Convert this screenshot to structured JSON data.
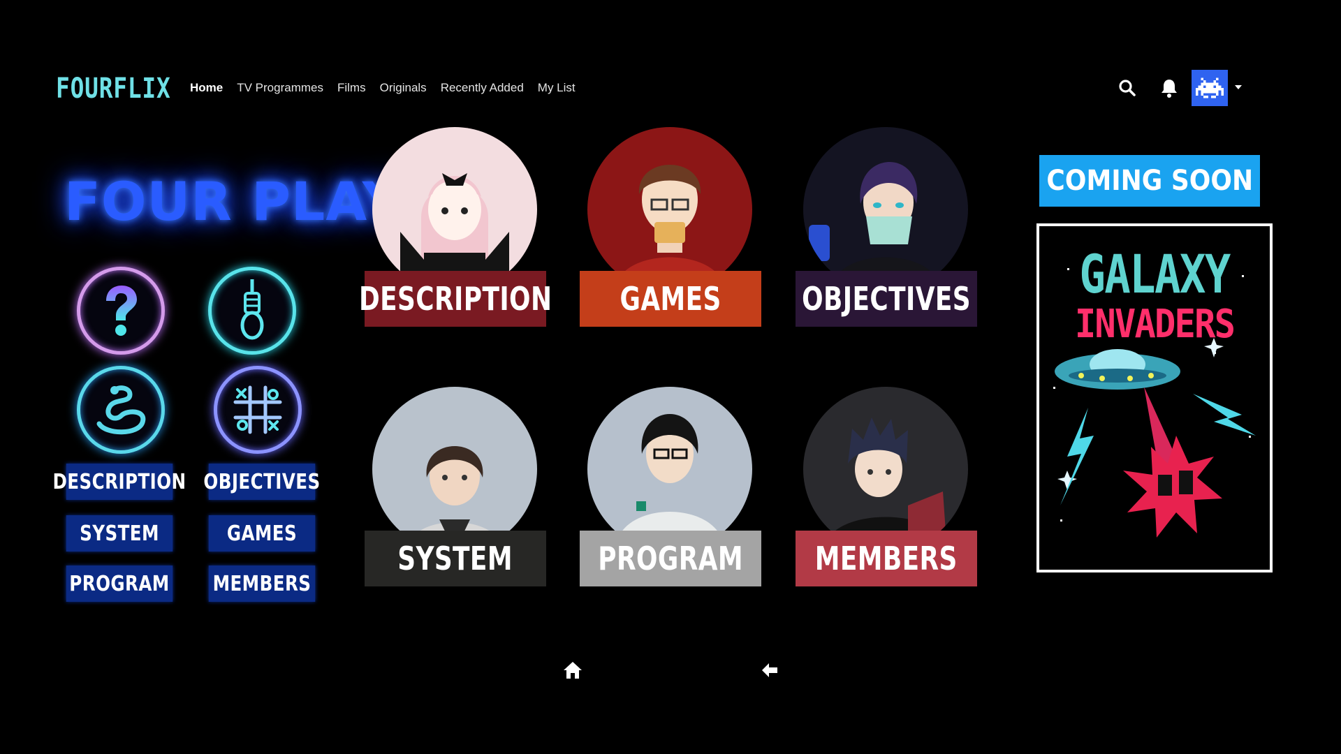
{
  "brand": {
    "logo": "FOURFLIX"
  },
  "nav": {
    "items": [
      {
        "label": "Home",
        "active": true
      },
      {
        "label": "TV Programmes"
      },
      {
        "label": "Films"
      },
      {
        "label": "Originals"
      },
      {
        "label": "Recently Added"
      },
      {
        "label": "My List"
      }
    ],
    "icons": [
      "search-icon",
      "bell-icon",
      "space-invader-avatar-icon",
      "caret-down-icon"
    ]
  },
  "left_panel": {
    "title": "FOUR PLAY",
    "game_icons": [
      "question-mark-icon",
      "noose-icon",
      "snake-icon",
      "tic-tac-toe-icon"
    ],
    "buttons": [
      "DESCRIPTION",
      "OBJECTIVES",
      "SYSTEM",
      "GAMES",
      "PROGRAM",
      "MEMBERS"
    ]
  },
  "cards": [
    {
      "label": "DESCRIPTION",
      "bar_color": "#7a1a22",
      "circle_color": "#f3dde0"
    },
    {
      "label": "GAMES",
      "bar_color": "#c43e1a",
      "circle_color": "#8c1616"
    },
    {
      "label": "OBJECTIVES",
      "bar_color": "#2a1636",
      "circle_color": "#141422"
    },
    {
      "label": "SYSTEM",
      "bar_color": "#272725",
      "circle_color": "#b9c2cc"
    },
    {
      "label": "PROGRAM",
      "bar_color": "#a4a4a4",
      "circle_color": "#b6c0cc"
    },
    {
      "label": "MEMBERS",
      "bar_color": "#b23a46",
      "circle_color": "#2a2a2e"
    }
  ],
  "right_panel": {
    "banner": "COMING SOON",
    "poster": {
      "line1": "GALAXY",
      "line2": "INVADERS"
    }
  },
  "bottom": {
    "icons": [
      "home-icon",
      "back-arrow-icon"
    ]
  }
}
